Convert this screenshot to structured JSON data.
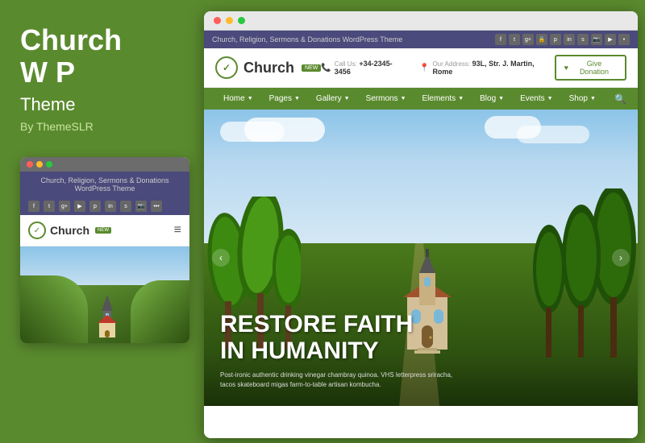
{
  "left": {
    "title_line1": "Church",
    "title_line2": "W P",
    "subtitle": "Theme",
    "by": "By ThemeSLR"
  },
  "browser": {
    "utility_text": "Church, Religion, Sermons & Donations WordPress Theme",
    "phone_label": "Call Us:",
    "phone": "+34-2345-3456",
    "address_label": "Our Address:",
    "address": "93L, Str. J. Martin, Rome",
    "donate_btn": "Give Donation",
    "logo_name": "Church",
    "logo_badge": "NEW",
    "nav_items": [
      "Home",
      "Pages",
      "Gallery",
      "Sermons",
      "Elements",
      "Blog",
      "Events",
      "Shop"
    ]
  },
  "hero": {
    "title_line1": "RESTORE FAITH",
    "title_line2": "IN HUMANITY",
    "subtitle": "Post-ironic authentic drinking vinegar chambray quinoa. VHS letterpress sriracha, tacos skateboard migas farm-to-table artisan kombucha."
  },
  "mobile": {
    "header_text": "Church, Religion, Sermons & Donations WordPress Theme",
    "logo_name": "Church",
    "logo_badge": "NEW"
  },
  "dots": {
    "red": "#ff5f57",
    "yellow": "#febc2e",
    "green": "#28c840"
  }
}
